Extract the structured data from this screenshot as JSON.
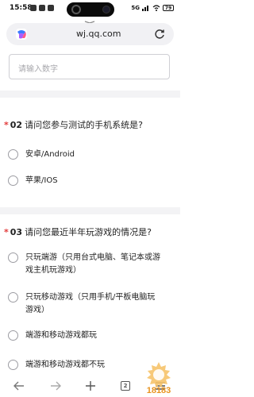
{
  "status_bar": {
    "time": "15:58",
    "battery": "79",
    "network": "5G"
  },
  "browser": {
    "url": "wj.qq.com",
    "tab_count": "2"
  },
  "survey": {
    "number_input_placeholder": "请输入数字",
    "questions": [
      {
        "required": "*",
        "number": "02",
        "title": "请问您参与测试的手机系统是?",
        "options": [
          "安卓/Android",
          "苹果/IOS"
        ]
      },
      {
        "required": "*",
        "number": "03",
        "title": "请问您最近半年玩游戏的情况是?",
        "options": [
          "只玩端游（只用台式电脑、笔记本或游戏主机玩游戏）",
          "只玩移动游戏（只用手机/平板电脑玩游戏）",
          "端游和移动游戏都玩",
          "端游和移动游戏都不玩"
        ]
      }
    ]
  },
  "watermark": {
    "text": "18183"
  },
  "colors": {
    "required_asterisk": "#e23a3a",
    "page_background": "#f3f3f5",
    "watermark": "#e8941f"
  }
}
